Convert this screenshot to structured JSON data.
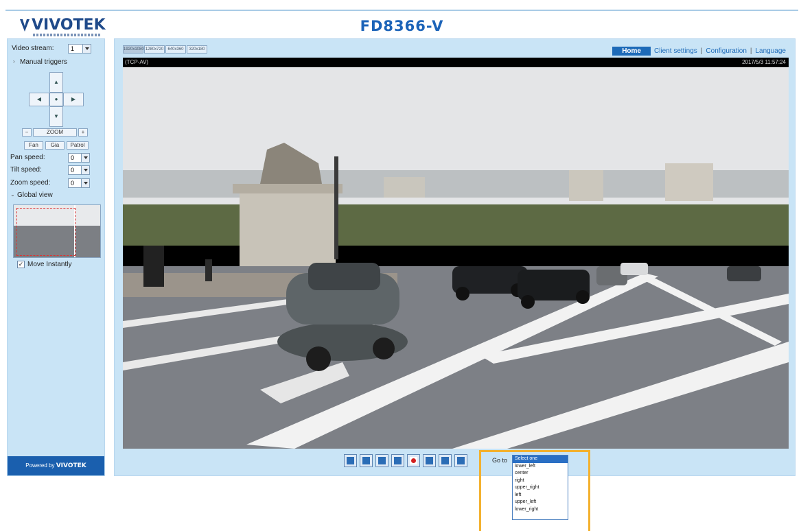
{
  "header": {
    "logo_text": "VIVOTEK",
    "model": "FD8366-V"
  },
  "left_panel": {
    "video_stream_label": "Video stream:",
    "video_stream_value": "1",
    "manual_triggers_label": "Manual triggers",
    "zoom_label": "ZOOM",
    "buttons": [
      "Fan",
      "Gia",
      "Patrol"
    ],
    "pan_speed_label": "Pan speed:",
    "pan_speed_value": "0",
    "tilt_speed_label": "Tilt speed:",
    "tilt_speed_value": "0",
    "zoom_speed_label": "Zoom speed:",
    "zoom_speed_value": "0",
    "global_view_label": "Global view",
    "move_instantly_label": "Move Instantly",
    "move_instantly_checked": "✓",
    "powered_by": "Powered by",
    "powered_brand": "VIVOTEK"
  },
  "main": {
    "stream_tabs": [
      "1920x1080",
      "1280x720",
      "640x360",
      "320x180"
    ],
    "nav": {
      "home": "Home",
      "client_settings": "Client settings",
      "configuration": "Configuration",
      "language": "Language"
    },
    "video": {
      "protocol": "(TCP-AV)",
      "timestamp": "2017/5/3 11:57:24"
    },
    "goto_label": "Go to",
    "control_icons": [
      "snapshot-icon",
      "digital-zoom-icon",
      "pause-icon",
      "stop-icon",
      "record-icon",
      "volume-icon",
      "mute-icon",
      "talk-icon"
    ]
  },
  "preset_dropdown": {
    "items": [
      "Select one",
      "lower_left",
      "center",
      "right",
      "upper_right",
      "left",
      "upper_left",
      "lower_right"
    ],
    "selected_index": 0
  },
  "colors": {
    "panel_bg": "#c9e4f6",
    "brand_blue": "#1b63b8",
    "highlight": "#f3b12f"
  }
}
